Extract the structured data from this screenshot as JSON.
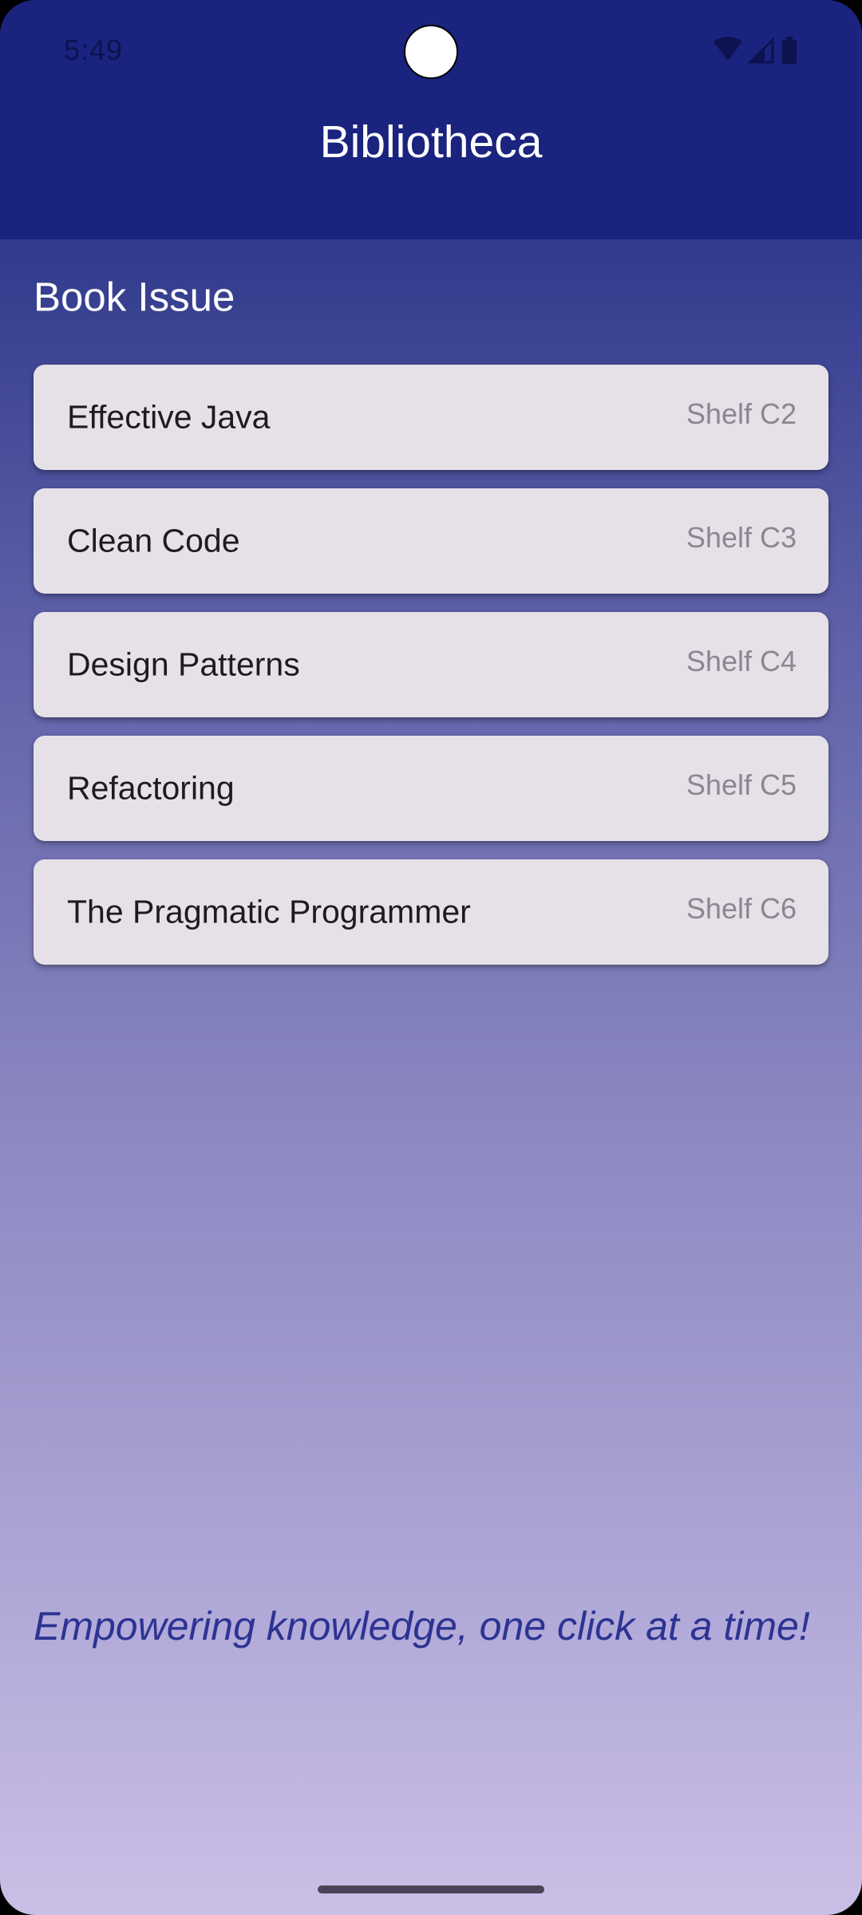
{
  "status_bar": {
    "time": "5:49",
    "icons": [
      "wifi-icon",
      "cellular-signal-icon",
      "battery-icon"
    ]
  },
  "app_bar": {
    "title": "Bibliotheca",
    "color": "#1A237E"
  },
  "section": {
    "title": "Book Issue"
  },
  "books": [
    {
      "title": "Effective Java",
      "shelf": "Shelf C2"
    },
    {
      "title": "Clean Code",
      "shelf": "Shelf C3"
    },
    {
      "title": "Design Patterns",
      "shelf": "Shelf C4"
    },
    {
      "title": "Refactoring",
      "shelf": "Shelf C5"
    },
    {
      "title": "The Pragmatic Programmer",
      "shelf": "Shelf C6"
    }
  ],
  "footer": {
    "tagline": "Empowering knowledge, one click at a time!"
  },
  "colors": {
    "card_background": "#E6E1E8",
    "tagline": "#2C3393",
    "gradient_top": "#313A8C",
    "gradient_bottom": "#CABFE6"
  }
}
